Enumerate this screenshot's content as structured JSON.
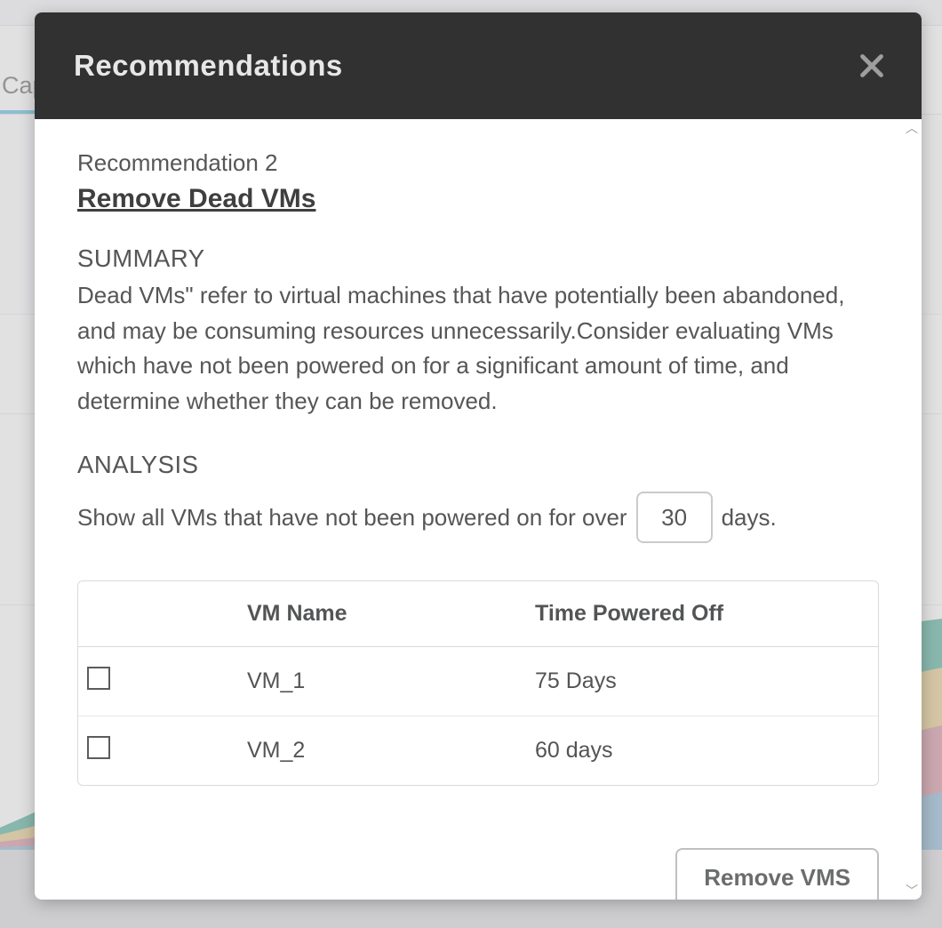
{
  "bg": {
    "tab_label": "Cap"
  },
  "modal": {
    "title": "Recommendations"
  },
  "recommendation": {
    "number_label": "Recommendation 2",
    "title": "Remove Dead VMs",
    "summary_head": "SUMMARY",
    "summary_text": "Dead VMs\" refer to virtual machines that have potentially been abandoned, and may be consuming resources unnecessarily.Consider evaluating VMs which have not been powered on for a significant amount of time, and determine whether they can be removed.",
    "analysis_head": "ANALYSIS",
    "analysis_prefix": "Show all VMs that have not been powered on for over",
    "analysis_days_value": "30",
    "analysis_suffix": "days."
  },
  "table": {
    "columns": {
      "name": "VM Name",
      "time": "Time Powered Off"
    },
    "rows": [
      {
        "name": "VM_1",
        "time": "75 Days"
      },
      {
        "name": "VM_2",
        "time": "60 days"
      }
    ]
  },
  "actions": {
    "remove_label": "Remove VMS"
  }
}
